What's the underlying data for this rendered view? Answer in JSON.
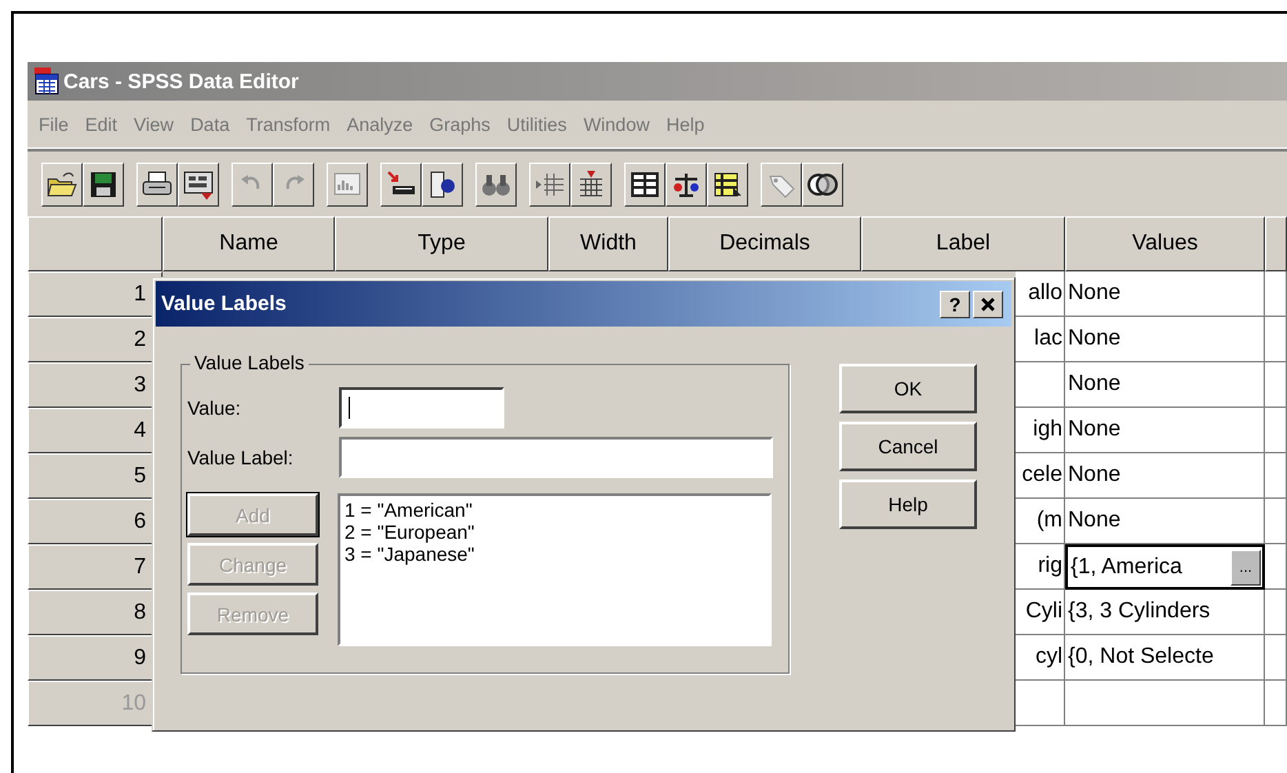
{
  "window": {
    "title": "Cars - SPSS Data Editor"
  },
  "menu": [
    "File",
    "Edit",
    "View",
    "Data",
    "Transform",
    "Analyze",
    "Graphs",
    "Utilities",
    "Window",
    "Help"
  ],
  "grid": {
    "columns": [
      "Name",
      "Type",
      "Width",
      "Decimals",
      "Label",
      "Values"
    ],
    "rows": [
      {
        "number": "1",
        "label": "allo",
        "values": "None",
        "selected": false,
        "greyed": false
      },
      {
        "number": "2",
        "label": "lac",
        "values": "None",
        "selected": false,
        "greyed": false
      },
      {
        "number": "3",
        "values": "None",
        "selected": false,
        "greyed": false
      },
      {
        "number": "4",
        "label": "igh",
        "values": "None",
        "selected": false,
        "greyed": false
      },
      {
        "number": "5",
        "label": "cele",
        "values": "None",
        "selected": false,
        "greyed": false
      },
      {
        "number": "6",
        "label": "(m",
        "values": "None",
        "selected": false,
        "greyed": false
      },
      {
        "number": "7",
        "label": "rig",
        "values": "{1, America",
        "selected": true,
        "greyed": false
      },
      {
        "number": "8",
        "label": "Cyli",
        "values": "{3, 3 Cylinders",
        "selected": false,
        "greyed": false
      },
      {
        "number": "9",
        "label": "cyl",
        "values": "{0, Not Selecte",
        "selected": false,
        "greyed": false
      },
      {
        "number": "10",
        "selected": false,
        "greyed": true
      }
    ],
    "edit_button": "..."
  },
  "dialog": {
    "title": "Value Labels",
    "help_button": "?",
    "group_title": "Value Labels",
    "fields": [
      {
        "label": "Value:",
        "focused": true
      },
      {
        "label": "Value Label:",
        "focused": false
      }
    ],
    "side_buttons": [
      {
        "label": "Add",
        "disabled": true,
        "default": true
      },
      {
        "label": "Change",
        "disabled": true,
        "default": false
      },
      {
        "label": "Remove",
        "disabled": true,
        "default": false
      }
    ],
    "list": [
      "1 = \"American\"",
      "2 = \"European\"",
      "3 = \"Japanese\""
    ],
    "buttons": [
      "OK",
      "Cancel",
      "Help"
    ]
  }
}
